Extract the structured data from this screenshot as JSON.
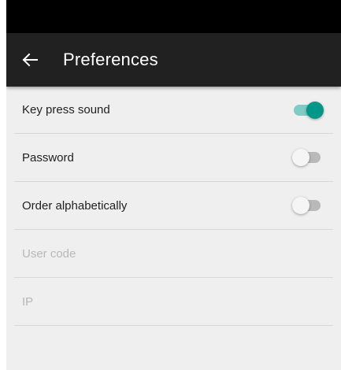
{
  "app_bar": {
    "title": "Preferences",
    "back_icon": "arrow-left-icon"
  },
  "colors": {
    "accent": "#009688",
    "accent_track": "#80cbc4",
    "app_bar": "#212121"
  },
  "preferences": [
    {
      "label": "Key press sound",
      "type": "switch",
      "checked": true,
      "enabled": true
    },
    {
      "label": "Password",
      "type": "switch",
      "checked": false,
      "enabled": true
    },
    {
      "label": "Order alphabetically",
      "type": "switch",
      "checked": false,
      "enabled": true
    },
    {
      "label": "User code",
      "type": "text",
      "enabled": false
    },
    {
      "label": "IP",
      "type": "text",
      "enabled": false
    }
  ]
}
